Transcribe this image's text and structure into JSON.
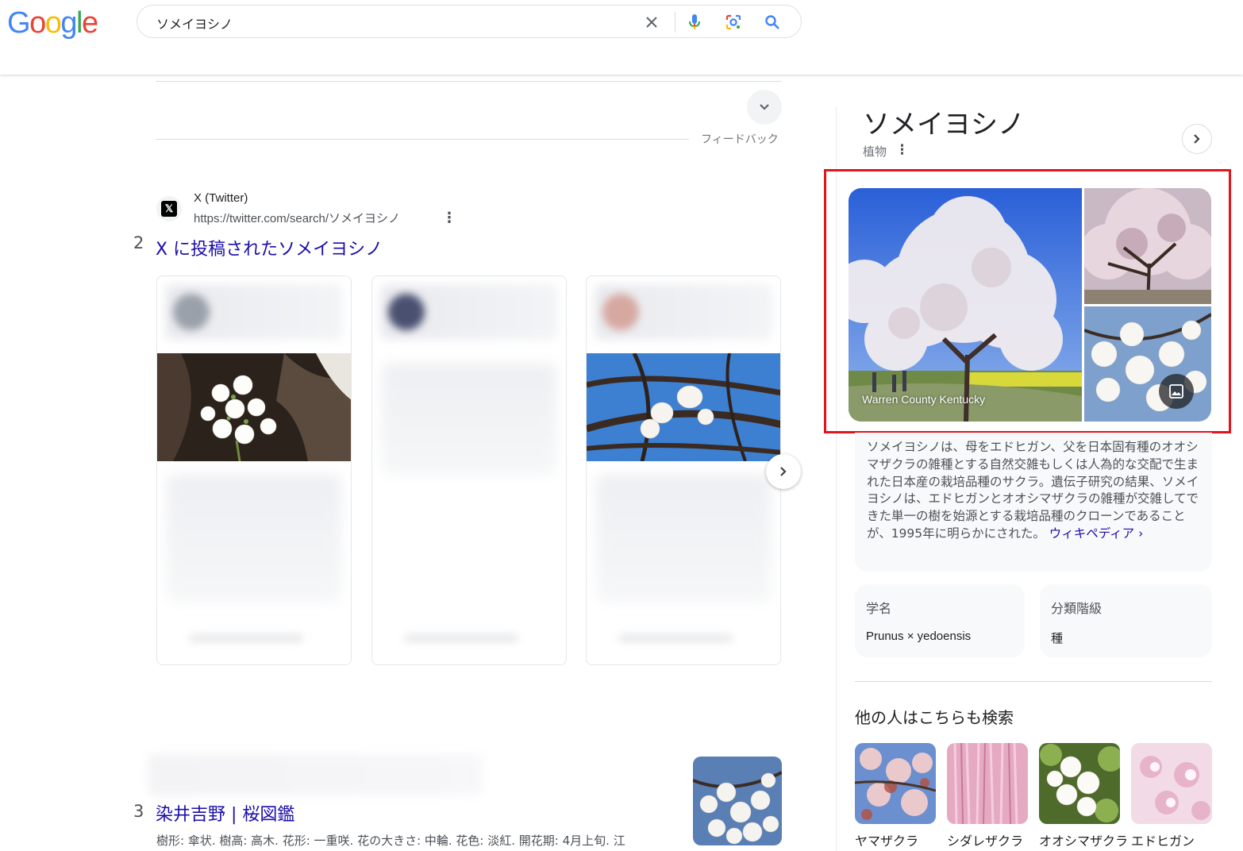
{
  "header": {
    "logo_letters": [
      {
        "ch": "G",
        "color": "#4285f4"
      },
      {
        "ch": "o",
        "color": "#ea4335"
      },
      {
        "ch": "o",
        "color": "#fbbc05"
      },
      {
        "ch": "g",
        "color": "#4285f4"
      },
      {
        "ch": "l",
        "color": "#34a853"
      },
      {
        "ch": "e",
        "color": "#ea4335"
      }
    ],
    "search_query": "ソメイヨシノ",
    "icons": [
      "clear-icon",
      "microphone-icon",
      "lens-icon",
      "search-icon"
    ]
  },
  "results": {
    "feedback_label": "フィードバック",
    "result2": {
      "number": "2",
      "site_name": "X (Twitter)",
      "url": "https://twitter.com/search/ソメイヨシノ",
      "title": "X に投稿されたソメイヨシノ"
    },
    "result3": {
      "number": "3",
      "title": "染井吉野 | 桜図鑑",
      "snippet": "樹形: 傘状. 樹高: 高木. 花形: 一重咲. 花の大きさ: 中輪. 花色: 淡紅. 開花期: 4月上旬. 江"
    }
  },
  "knowledge_panel": {
    "title": "ソメイヨシノ",
    "subtitle": "植物",
    "image_caption": "Warren County Kentucky",
    "description": "ソメイヨシノは、母をエドヒガン、父を日本固有種のオオシマザクラの雑種とする自然交雑もしくは人為的な交配で生まれた日本産の栽培品種のサクラ。遺伝子研究の結果、ソメイヨシノは、エドヒガンとオオシマザクラの雑種が交雑してできた単一の樹を始源とする栽培品種のクローンであることが、1995年に明らかにされた。",
    "wiki_link": "ウィキペディア ›",
    "facts": [
      {
        "label": "学名",
        "value": "Prunus × yedoensis"
      },
      {
        "label": "分類階級",
        "value": "種"
      }
    ],
    "others_title": "他の人はこちらも検索",
    "related": [
      {
        "label": "ヤマザクラ"
      },
      {
        "label": "シダレザクラ"
      },
      {
        "label": "オオシマザクラ"
      },
      {
        "label": "エドヒガン"
      }
    ]
  },
  "colors": {
    "link": "#1a0dab",
    "highlight_border": "#e3141c"
  }
}
